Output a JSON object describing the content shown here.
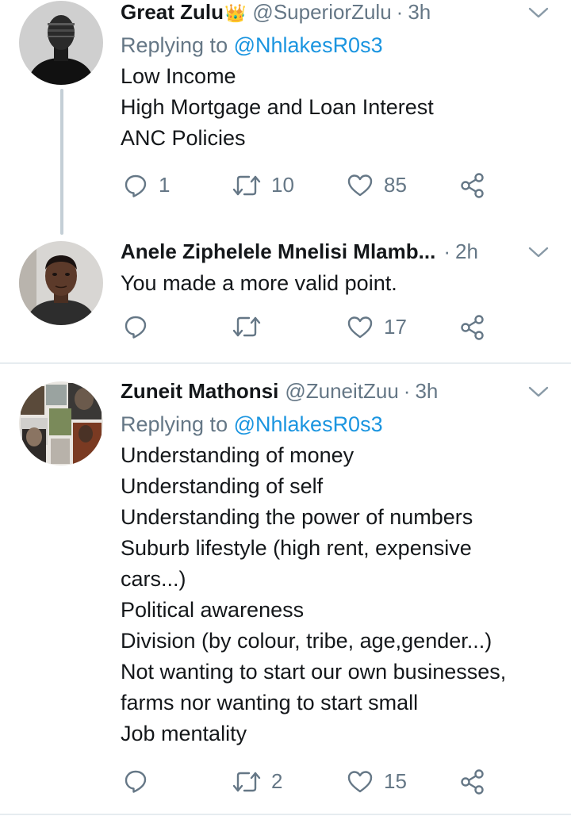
{
  "tweets": [
    {
      "name": "Great Zulu",
      "badge": "👑",
      "handle": "@SuperiorZulu",
      "sep": "·",
      "time": "3h",
      "replying_prefix": "Replying to",
      "replying_to": "@NhlakesR0s3",
      "lines": [
        "Low Income",
        "High Mortgage and Loan Interest",
        "ANC Policies"
      ],
      "reply_count": "1",
      "retweet_count": "10",
      "like_count": "85"
    },
    {
      "name": "Anele Ziphelele Mnelisi Mlamb...",
      "sep": "·",
      "time": "2h",
      "lines": [
        "You made a more valid point."
      ],
      "reply_count": "",
      "retweet_count": "",
      "like_count": "17"
    },
    {
      "name": "Zuneit Mathonsi",
      "handle": "@ZuneitZuu",
      "sep": "·",
      "time": "3h",
      "replying_prefix": "Replying to",
      "replying_to": "@NhlakesR0s3",
      "lines": [
        "Understanding of money",
        "Understanding of self",
        "Understanding the power of numbers",
        "Suburb lifestyle (high rent, expensive",
        "cars...)",
        "Political awareness",
        "Division (by colour, tribe, age,gender...)",
        "Not wanting to start our own businesses,",
        "farms nor wanting to start small",
        "Job mentality"
      ],
      "reply_count": "",
      "retweet_count": "2",
      "like_count": "15"
    }
  ],
  "colors": {
    "secondary_text": "#657786",
    "link": "#1b95e0",
    "divider": "#e6ecf0",
    "thread_line": "#c4cfd6"
  },
  "icons": [
    "reply-icon",
    "retweet-icon",
    "like-icon",
    "share-icon",
    "chevron-down-icon"
  ]
}
